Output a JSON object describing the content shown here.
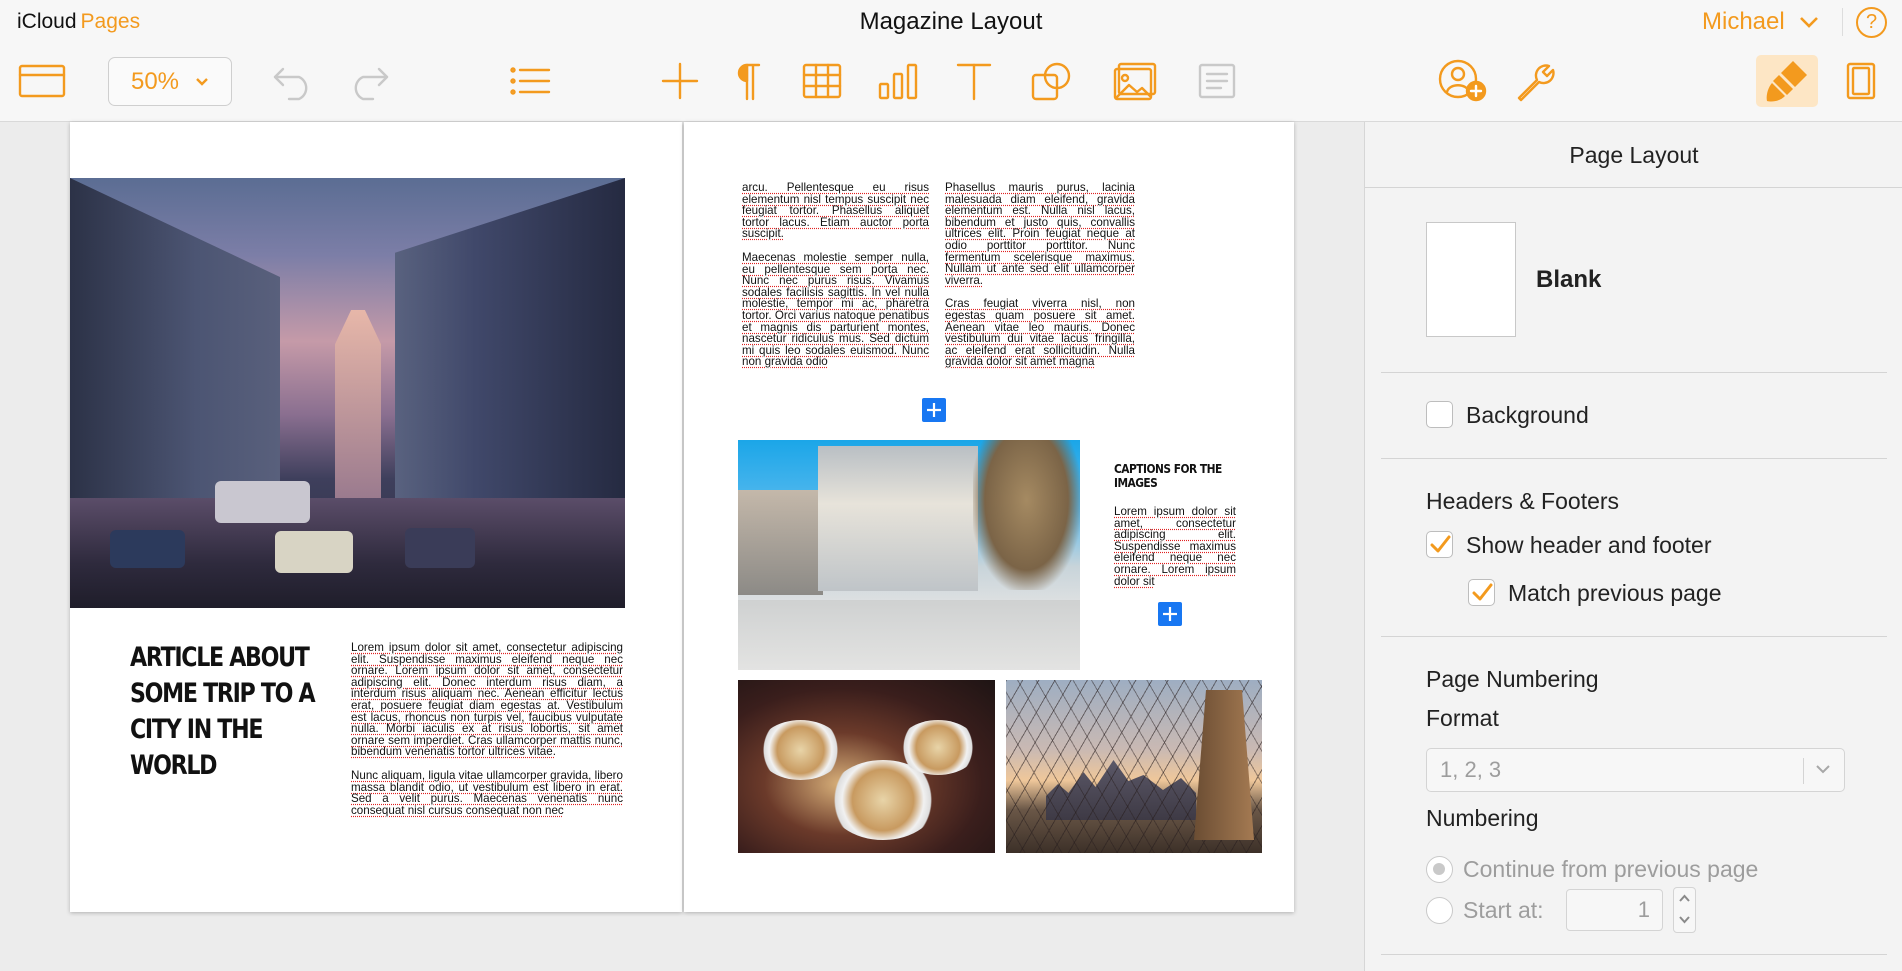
{
  "app": {
    "brand_left": "iCloud",
    "brand_right": "Pages",
    "doc_title": "Magazine Layout"
  },
  "user": {
    "name": "Michael",
    "help": "?"
  },
  "toolbar": {
    "zoom": "50%",
    "items": [
      "view-icon",
      "undo-icon",
      "redo-icon",
      "list-icon",
      "insert-icon",
      "paragraph-icon",
      "table-icon",
      "chart-icon",
      "text-icon",
      "shape-icon",
      "media-icon",
      "comment-icon",
      "collaborate-icon",
      "settings-icon",
      "format-icon",
      "document-icon"
    ],
    "accent_color": "#f39a1e"
  },
  "document": {
    "headline": "ARTICLE ABOUT SOME TRIP TO A CITY IN THE WORLD",
    "left_paragraphs": [
      "Lorem ipsum dolor sit amet, consectetur adipiscing elit. Suspendisse maximus eleifend neque nec ornare. Lorem ipsum dolor sit amet, consectetur adipiscing elit. Donec interdum risus diam, a interdum risus aliquam nec. Aenean efficitur lectus erat, posuere feugiat diam egestas at. Vestibulum est lacus, rhoncus non turpis vel, faucibus vulputate nulla. Morbi iaculis ex at risus lobortis, sit amet ornare sem imperdiet. Cras ullamcorper mattis nunc, bibendum venenatis tortor ultrices vitae.",
      "Nunc aliquam, ligula vitae ullamcorper gravida, libero massa blandit odio, ut vestibulum est libero in erat. Sed a velit purus. Maecenas venenatis nunc consequat nisl cursus consequat non nec"
    ],
    "right_col1_paragraphs": [
      "arcu. Pellentesque eu risus elementum nisl tempus suscipit nec feugiat tortor. Phasellus aliquet tortor lacus. Etiam auctor porta suscipit.",
      "Maecenas molestie semper nulla, eu pellentesque sem porta nec. Nunc nec purus risus. Vivamus sodales facilisis sagittis. In vel nulla molestie, tempor mi ac, pharetra tortor. Orci varius natoque penatibus et magnis dis parturient montes, nascetur ridiculus mus. Sed dictum mi quis leo sodales euismod. Nunc non gravida odio"
    ],
    "right_col2_paragraphs": [
      "Phasellus mauris purus, lacinia malesuada diam eleifend, gravida elementum est. Nulla nisl lacus, bibendum et justo quis, convallis ultrices elit. Proin feugiat neque at odio porttitor porttitor. Nunc fermentum scelerisque maximus. Nullam ut ante sed elit ullamcorper viverra.",
      "Cras feugiat viverra nisl, non egestas quam posuere sit amet. Aenean vitae leo mauris. Donec vestibulum dui vitae lacus fringilla, ac eleifend erat sollicitudin. Nulla gravida dolor sit amet magna"
    ],
    "caption_heading": "CAPTIONS FOR THE IMAGES",
    "caption_text": "Lorem ipsum dolor sit amet, consectetur adipiscing elit. Suspendisse maximus eleifend neque nec ornare. Lorem ipsum dolor sit"
  },
  "inspector": {
    "title": "Page Layout",
    "template_name": "Blank",
    "background_label": "Background",
    "background_checked": false,
    "headers_heading": "Headers & Footers",
    "show_header_label": "Show header and footer",
    "show_header_checked": true,
    "match_previous_label": "Match previous page",
    "match_previous_checked": true,
    "numbering_heading": "Page Numbering",
    "format_label": "Format",
    "format_value": "1, 2, 3",
    "numbering_label": "Numbering",
    "continue_label": "Continue from previous page",
    "start_label": "Start at:",
    "start_value": "1"
  }
}
